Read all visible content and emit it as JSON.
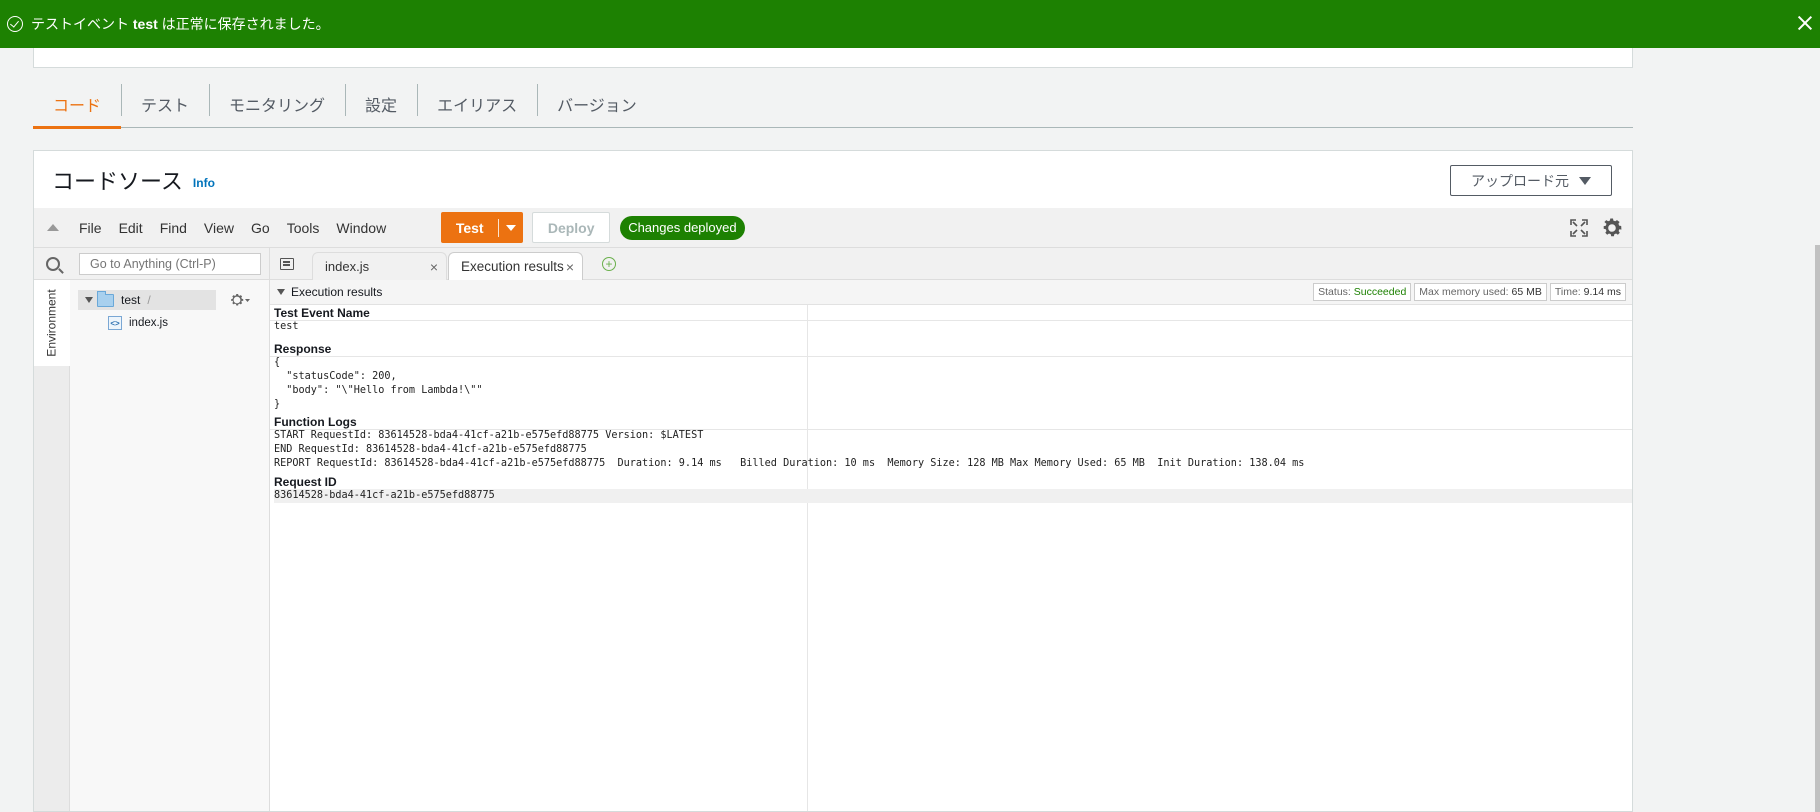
{
  "flash": {
    "prefix": "テストイベント ",
    "event_name": "test",
    "suffix": " は正常に保存されました。"
  },
  "tabs": [
    "コード",
    "テスト",
    "モニタリング",
    "設定",
    "エイリアス",
    "バージョン"
  ],
  "code_source": {
    "title": "コードソース",
    "info": "Info",
    "upload_button": "アップロード元"
  },
  "menubar": {
    "items": [
      "File",
      "Edit",
      "Find",
      "View",
      "Go",
      "Tools",
      "Window"
    ],
    "test_button": "Test",
    "deploy_button": "Deploy",
    "deployed_badge": "Changes deployed"
  },
  "sidebar": {
    "search_placeholder": "Go to Anything (Ctrl-P)",
    "environment_tab": "Environment",
    "root_folder": "test",
    "root_slash": "/",
    "file": "index.js"
  },
  "editor_tabs": {
    "tab1": "index.js",
    "tab2": "Execution results",
    "close": "×",
    "add": "+"
  },
  "results": {
    "title": "Execution results",
    "status_label": "Status: ",
    "status_value": "Succeeded",
    "memory_label": "Max memory used: ",
    "memory_value": "65 MB",
    "time_label": "Time: ",
    "time_value": "9.14 ms",
    "test_event_heading": "Test Event Name",
    "test_event_value": "test",
    "response_heading": "Response",
    "response_body": "{\n  \"statusCode\": 200,\n  \"body\": \"\\\"Hello from Lambda!\\\"\"\n}",
    "logs_heading": "Function Logs",
    "logs_body": "START RequestId: 83614528-bda4-41cf-a21b-e575efd88775 Version: $LATEST\nEND RequestId: 83614528-bda4-41cf-a21b-e575efd88775\nREPORT RequestId: 83614528-bda4-41cf-a21b-e575efd88775  Duration: 9.14 ms   Billed Duration: 10 ms  Memory Size: 128 MB Max Memory Used: 65 MB  Init Duration: 138.04 ms",
    "request_id_heading": "Request ID",
    "request_id_value": "83614528-bda4-41cf-a21b-e575efd88775"
  },
  "colors": {
    "flash_bg": "#1d8102",
    "accent": "#ec7211",
    "link": "#0073bb"
  }
}
